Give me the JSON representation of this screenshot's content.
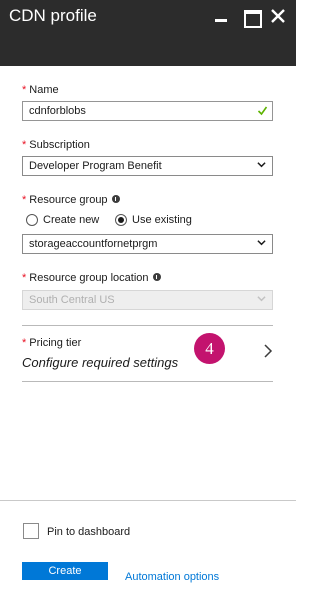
{
  "window": {
    "title": "CDN profile"
  },
  "name_field": {
    "label": "Name",
    "value": "cdnforblobs"
  },
  "subscription": {
    "label": "Subscription",
    "selected": "Developer Program Benefit"
  },
  "resource_group": {
    "label": "Resource group",
    "options": [
      {
        "label": "Create new",
        "checked": false
      },
      {
        "label": "Use existing",
        "checked": true
      }
    ],
    "selected": "storageaccountfornetprgm"
  },
  "resource_group_location": {
    "label": "Resource group location",
    "selected": "South Central US",
    "disabled": true
  },
  "pricing_tier": {
    "label": "Pricing tier",
    "value": "Configure required settings",
    "step_badge": "4"
  },
  "footer": {
    "pin_label": "Pin to dashboard",
    "pin_checked": false,
    "create_label": "Create",
    "automation_label": "Automation options"
  },
  "colors": {
    "header_bg": "#2c2c2c",
    "accent": "#0078d7",
    "required": "#e81123",
    "badge": "#c3136e",
    "valid_check": "#5db300"
  }
}
